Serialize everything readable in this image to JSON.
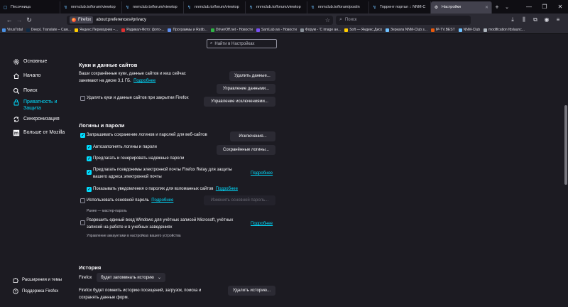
{
  "tabs": [
    {
      "title": "Песочница",
      "active": false
    },
    {
      "title": "nnmclub.to/forum/viewtop",
      "active": false
    },
    {
      "title": "nnmclub.to/forum/viewtop",
      "active": false
    },
    {
      "title": "nnmclub.to/forum/viewtop",
      "active": false
    },
    {
      "title": "nnmclub.to/forum/viewtop",
      "active": false
    },
    {
      "title": "nnmclub.to/forum/postin",
      "active": false
    },
    {
      "title": "Торрент портал :: NNM-C",
      "active": false
    },
    {
      "title": "Настройки",
      "active": true
    }
  ],
  "urlbar": {
    "identity": "Firefox",
    "url": "about:preferences#privacy"
  },
  "searchbar": {
    "placeholder": "Поиск"
  },
  "bookmarks": [
    "VirusTotal",
    "DeepL Translate – Сам...",
    "Яндекс.Переводчик –...",
    "Радикал-Фото: фото-...",
    "Программы и Ratib...",
    "DriverOff.net - Новости",
    "SamLab.ws - Новости",
    "Форум - 'С image ан...",
    "Soft — Яндекс.Диск",
    "Зеркала NNM-Club з...",
    "IP-TV.BEST",
    "NNM-Club",
    "modification fdslaunc..."
  ],
  "sidebar": {
    "items": [
      {
        "label": "Основные",
        "icon": "gear-icon"
      },
      {
        "label": "Начало",
        "icon": "home-icon"
      },
      {
        "label": "Поиск",
        "icon": "search-icon"
      },
      {
        "label": "Приватность и Защита",
        "icon": "lock-icon"
      },
      {
        "label": "Синхронизация",
        "icon": "sync-icon"
      },
      {
        "label": "Больше от Mozilla",
        "icon": "mozilla-icon"
      }
    ],
    "footer": [
      "Расширения и темы",
      "Поддержка Firefox"
    ]
  },
  "find": {
    "placeholder": "Найти в Настройках"
  },
  "cookies": {
    "heading": "Куки и данные сайтов",
    "desc1": "Ваши сохранённые куки, данные сайтов и кеш сейчас",
    "desc2": "занимают на диске 3,1 ГБ.",
    "learn_more": "Подробнее",
    "delete_on_close": "Удалять куки и данные сайтов при закрытии Firefox",
    "btn_clear": "Удалить данные...",
    "btn_manage": "Управление данными...",
    "btn_exceptions": "Управление исключениями..."
  },
  "logins": {
    "heading": "Логины и пароли",
    "ask_save": "Запрашивать сохранение логинов и паролей для веб-сайтов",
    "autofill": "Автозаполнять логины и пароли",
    "suggest": "Предлагать и генерировать надежные пароли",
    "relay1": "Предлагать псевдонимы электронной почты Firefox Relay для защиты",
    "relay2": "вашего адреса электронной почты",
    "relay_more": "Подробнее",
    "breach": "Показывать уведомления о паролях для взломанных сайтов",
    "breach_more": "Подробнее",
    "primary": "Использовать основной пароль",
    "primary_more": "Подробнее",
    "primary_sub": "Ранее — мастер-пароль",
    "windows1": "Разрешить единый вход Windows для учётных записей Microsoft, учётных",
    "windows2": "записей на работе и в учебных заведениях",
    "windows_more": "Подробнее",
    "windows_sub": "Управление аккаунтами в настройках вашего устройства",
    "btn_exceptions": "Исключения...",
    "btn_saved": "Сохранённые логины...",
    "btn_change_primary": "Изменить основной пароль..."
  },
  "history": {
    "heading": "История",
    "firefox_label": "Firefox",
    "mode": "будет запоминать историю",
    "desc1": "Firefox будет помнить историю посещений, загрузок, поиска и",
    "desc2": "сохранять данные форм.",
    "btn_clear": "Удалить историю..."
  }
}
